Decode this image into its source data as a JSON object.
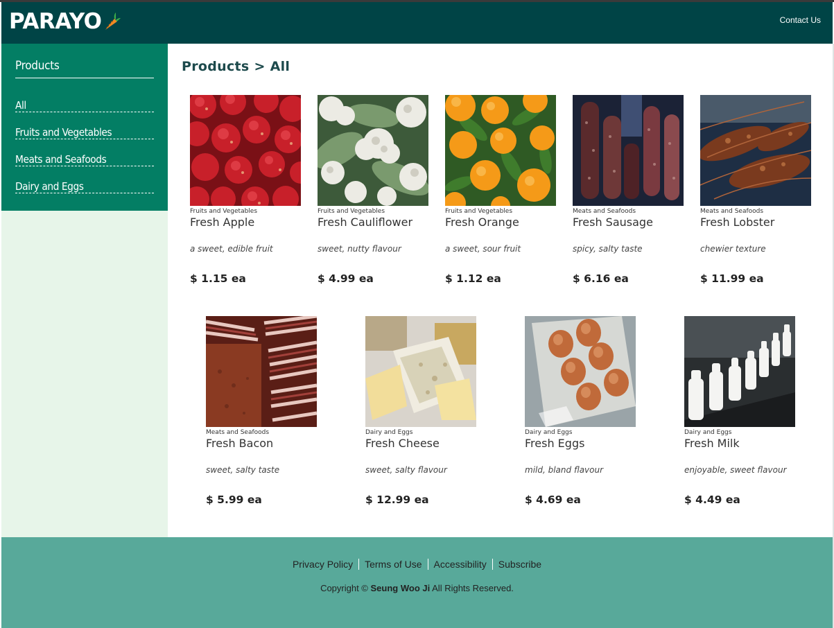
{
  "header": {
    "logo_text": "PARAYO",
    "contact_label": "Contact Us"
  },
  "sidebar": {
    "title": "Products",
    "items": [
      {
        "label": "All"
      },
      {
        "label": "Fruits and Vegetables"
      },
      {
        "label": "Meats and Seafoods"
      },
      {
        "label": "Dairy and Eggs"
      }
    ]
  },
  "main": {
    "breadcrumb": "Products > All"
  },
  "products": [
    {
      "category": "Fruits and Vegetables",
      "name": "Fresh Apple",
      "description": "a sweet, edible fruit",
      "price": "$ 1.15 ea",
      "image_icon": "apple-photo"
    },
    {
      "category": "Fruits and Vegetables",
      "name": "Fresh Cauliflower",
      "description": "sweet, nutty flavour",
      "price": "$ 4.99 ea",
      "image_icon": "cauliflower-photo"
    },
    {
      "category": "Fruits and Vegetables",
      "name": "Fresh Orange",
      "description": "a sweet, sour fruit",
      "price": "$ 1.12 ea",
      "image_icon": "orange-photo"
    },
    {
      "category": "Meats and Seafoods",
      "name": "Fresh Sausage",
      "description": "spicy, salty taste",
      "price": "$ 6.16 ea",
      "image_icon": "sausage-photo"
    },
    {
      "category": "Meats and Seafoods",
      "name": "Fresh Lobster",
      "description": "chewier texture",
      "price": "$ 11.99 ea",
      "image_icon": "lobster-photo"
    },
    {
      "category": "Meats and Seafoods",
      "name": "Fresh Bacon",
      "description": "sweet, salty taste",
      "price": "$ 5.99 ea",
      "image_icon": "bacon-photo"
    },
    {
      "category": "Dairy and Eggs",
      "name": "Fresh Cheese",
      "description": "sweet, salty flavour",
      "price": "$ 12.99 ea",
      "image_icon": "cheese-photo"
    },
    {
      "category": "Dairy and Eggs",
      "name": "Fresh Eggs",
      "description": "mild, bland flavour",
      "price": "$ 4.69 ea",
      "image_icon": "eggs-photo"
    },
    {
      "category": "Dairy and Eggs",
      "name": "Fresh Milk",
      "description": "enjoyable, sweet flavour",
      "price": "$ 4.49 ea",
      "image_icon": "milk-photo"
    }
  ],
  "footer": {
    "links": [
      {
        "label": "Privacy Policy"
      },
      {
        "label": "Terms of Use"
      },
      {
        "label": "Accessibility"
      },
      {
        "label": "Subscribe"
      }
    ],
    "copyright_prefix": "Copyright ©",
    "copyright_owner": "Seung Woo Ji",
    "copyright_suffix": "All Rights Reserved."
  },
  "colors": {
    "header_bg": "#004446",
    "sidebar_bg": "#037e64",
    "sidebar_rest_bg": "#e7f5e9",
    "footer_bg": "#58a99a",
    "carrot": "#f08a24",
    "carrot_leaf": "#3cae4a"
  }
}
